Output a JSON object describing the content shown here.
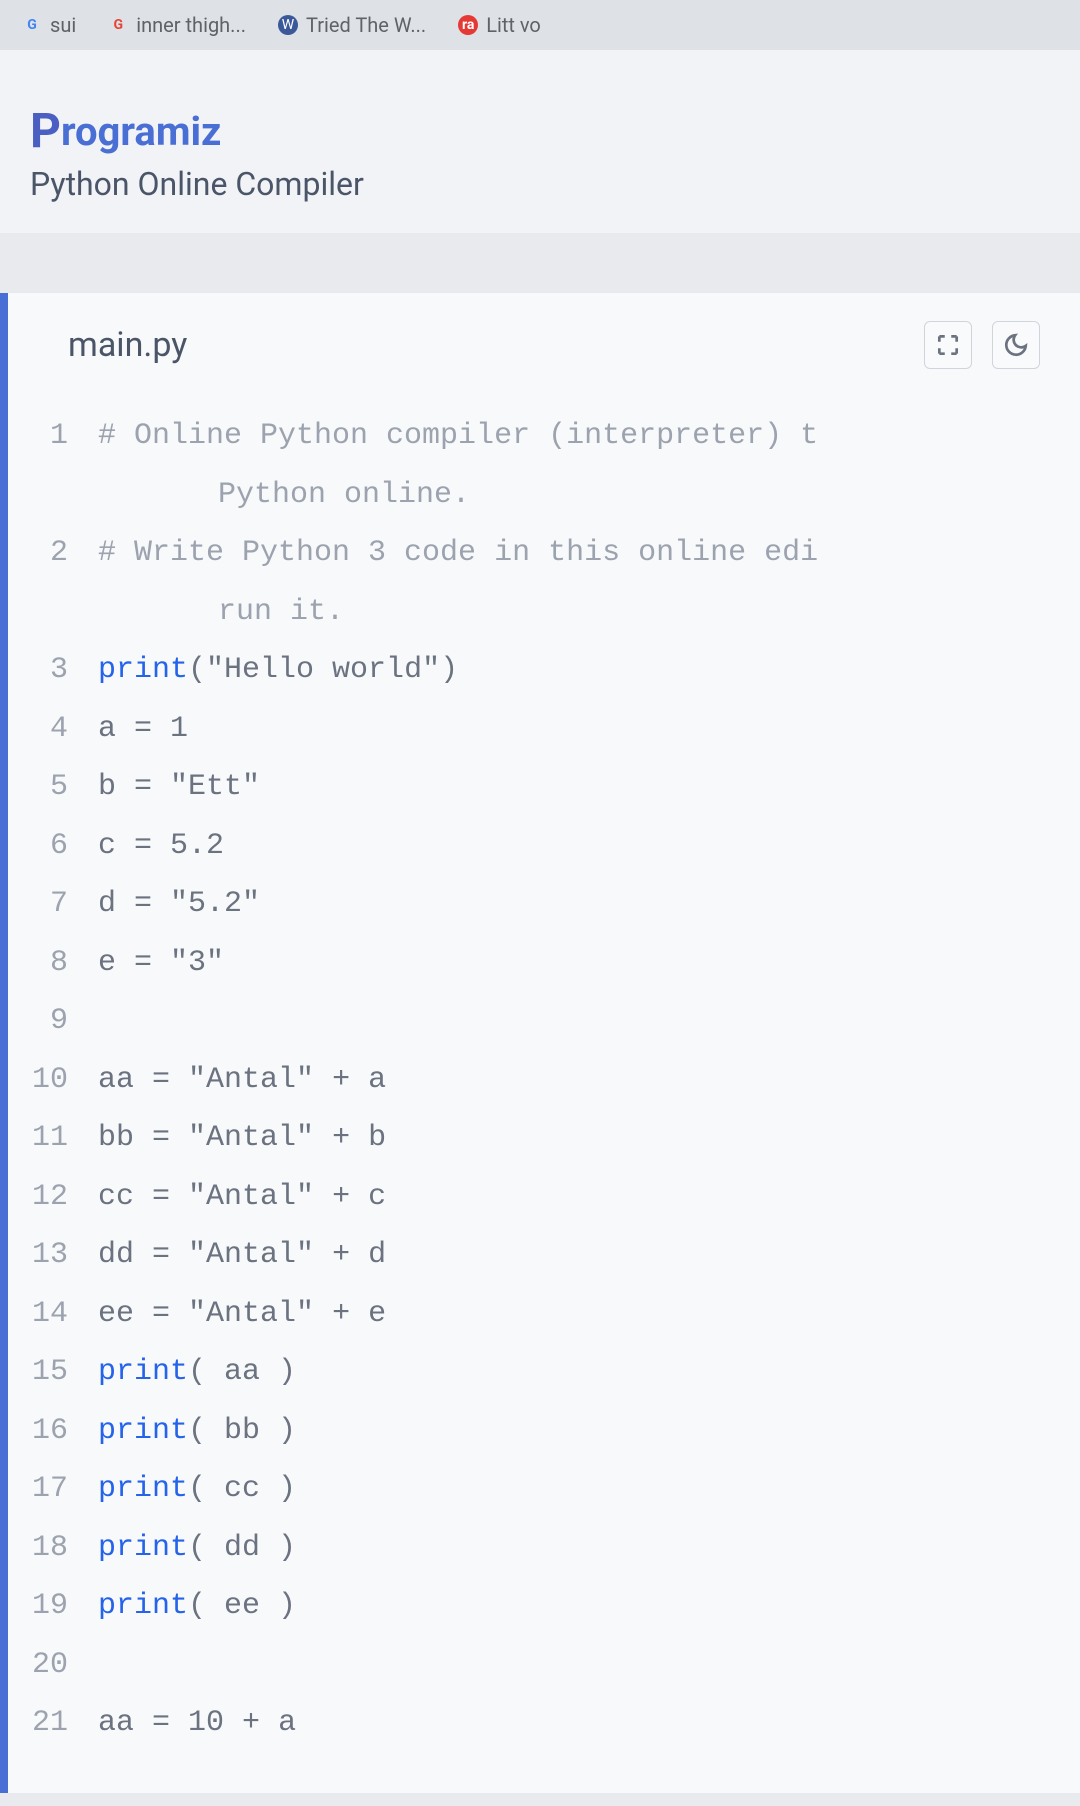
{
  "browser": {
    "tabs": [
      {
        "label": "sui"
      },
      {
        "label": "inner thigh..."
      },
      {
        "label": "Tried The W..."
      },
      {
        "label": "Litt vo"
      }
    ]
  },
  "brand": {
    "name_first": "P",
    "name_rest": "rogramiz",
    "subtitle": "Python Online Compiler"
  },
  "editor": {
    "filename": "main.py",
    "icons": {
      "fullscreen": "fullscreen-icon",
      "theme": "theme-toggle-icon"
    }
  },
  "code": {
    "lines": [
      {
        "n": "1",
        "tokens": [
          {
            "t": "# Online Python compiler (interpreter) t",
            "c": "comment"
          }
        ]
      },
      {
        "n": "",
        "indent": true,
        "tokens": [
          {
            "t": "Python online.",
            "c": "comment"
          }
        ]
      },
      {
        "n": "2",
        "tokens": [
          {
            "t": "# Write Python 3 code in this online edi",
            "c": "comment"
          }
        ]
      },
      {
        "n": "",
        "indent": true,
        "tokens": [
          {
            "t": "run it.",
            "c": "comment"
          }
        ]
      },
      {
        "n": "3",
        "tokens": [
          {
            "t": "print",
            "c": "builtin"
          },
          {
            "t": "(",
            "c": "punct"
          },
          {
            "t": "\"Hello world\"",
            "c": "string"
          },
          {
            "t": ")",
            "c": "punct"
          }
        ]
      },
      {
        "n": "4",
        "tokens": [
          {
            "t": "a ",
            "c": "name"
          },
          {
            "t": "=",
            "c": "op"
          },
          {
            "t": " 1",
            "c": "number"
          }
        ]
      },
      {
        "n": "5",
        "tokens": [
          {
            "t": "b ",
            "c": "name"
          },
          {
            "t": "=",
            "c": "op"
          },
          {
            "t": " \"Ett\"",
            "c": "string"
          }
        ]
      },
      {
        "n": "6",
        "tokens": [
          {
            "t": "c ",
            "c": "name"
          },
          {
            "t": "=",
            "c": "op"
          },
          {
            "t": " 5.2",
            "c": "number"
          }
        ]
      },
      {
        "n": "7",
        "tokens": [
          {
            "t": "d ",
            "c": "name"
          },
          {
            "t": "=",
            "c": "op"
          },
          {
            "t": " \"5.2\"",
            "c": "string"
          }
        ]
      },
      {
        "n": "8",
        "tokens": [
          {
            "t": "e ",
            "c": "name"
          },
          {
            "t": "=",
            "c": "op"
          },
          {
            "t": " \"3\"",
            "c": "string"
          }
        ]
      },
      {
        "n": "9",
        "tokens": []
      },
      {
        "n": "10",
        "tokens": [
          {
            "t": "aa ",
            "c": "name"
          },
          {
            "t": "=",
            "c": "op"
          },
          {
            "t": " \"Antal\"",
            "c": "string"
          },
          {
            "t": " + ",
            "c": "op"
          },
          {
            "t": "a",
            "c": "name"
          }
        ]
      },
      {
        "n": "11",
        "tokens": [
          {
            "t": "bb ",
            "c": "name"
          },
          {
            "t": "=",
            "c": "op"
          },
          {
            "t": " \"Antal\"",
            "c": "string"
          },
          {
            "t": " + ",
            "c": "op"
          },
          {
            "t": "b",
            "c": "name"
          }
        ]
      },
      {
        "n": "12",
        "tokens": [
          {
            "t": "cc ",
            "c": "name"
          },
          {
            "t": "=",
            "c": "op"
          },
          {
            "t": " \"Antal\"",
            "c": "string"
          },
          {
            "t": " + ",
            "c": "op"
          },
          {
            "t": "c",
            "c": "name"
          }
        ]
      },
      {
        "n": "13",
        "tokens": [
          {
            "t": "dd ",
            "c": "name"
          },
          {
            "t": "=",
            "c": "op"
          },
          {
            "t": " \"Antal\"",
            "c": "string"
          },
          {
            "t": " + ",
            "c": "op"
          },
          {
            "t": "d",
            "c": "name"
          }
        ]
      },
      {
        "n": "14",
        "tokens": [
          {
            "t": "ee ",
            "c": "name"
          },
          {
            "t": "=",
            "c": "op"
          },
          {
            "t": " \"Antal\"",
            "c": "string"
          },
          {
            "t": " + ",
            "c": "op"
          },
          {
            "t": "e",
            "c": "name"
          }
        ]
      },
      {
        "n": "15",
        "tokens": [
          {
            "t": "print",
            "c": "builtin"
          },
          {
            "t": "( aa )",
            "c": "punct"
          }
        ]
      },
      {
        "n": "16",
        "tokens": [
          {
            "t": "print",
            "c": "builtin"
          },
          {
            "t": "( bb )",
            "c": "punct"
          }
        ]
      },
      {
        "n": "17",
        "tokens": [
          {
            "t": "print",
            "c": "builtin"
          },
          {
            "t": "( cc )",
            "c": "punct"
          }
        ]
      },
      {
        "n": "18",
        "tokens": [
          {
            "t": "print",
            "c": "builtin"
          },
          {
            "t": "( dd )",
            "c": "punct"
          }
        ]
      },
      {
        "n": "19",
        "tokens": [
          {
            "t": "print",
            "c": "builtin"
          },
          {
            "t": "( ee )",
            "c": "punct"
          }
        ]
      },
      {
        "n": "20",
        "tokens": []
      },
      {
        "n": "21",
        "tokens": [
          {
            "t": "aa ",
            "c": "name"
          },
          {
            "t": "=",
            "c": "op"
          },
          {
            "t": " 10",
            "c": "number"
          },
          {
            "t": " + ",
            "c": "op"
          },
          {
            "t": "a",
            "c": "name"
          }
        ]
      }
    ]
  }
}
